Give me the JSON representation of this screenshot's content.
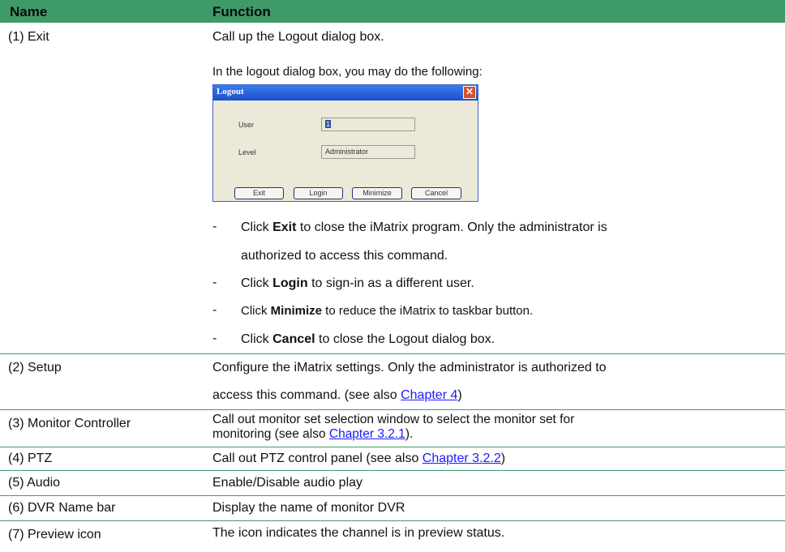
{
  "header": {
    "name": "Name",
    "function": "Function"
  },
  "rows": [
    {
      "name": "(1) Exit",
      "line1": "Call up the Logout dialog box.",
      "line2": "In the logout dialog box, you may do the following:",
      "bullets": [
        {
          "dash": "-",
          "pre": "Click ",
          "bold": "Exit",
          "post": " to close the iMatrix program. Only the administrator is",
          "cont": "authorized to access this command."
        },
        {
          "dash": "-",
          "pre": "Click ",
          "bold": "Login",
          "post": " to sign-in as a different user."
        },
        {
          "dash": "-",
          "pre": "Click ",
          "bold": "Minimize",
          "post": " to reduce the iMatrix to taskbar button."
        },
        {
          "dash": "-",
          "pre": "Click ",
          "bold": "Cancel",
          "post": " to close the Logout dialog box."
        }
      ]
    },
    {
      "name": "(2) Setup",
      "line1": "Configure the iMatrix settings. Only the administrator is authorized to",
      "line2pre": "access this command. (see also ",
      "link": "Chapter 4",
      "post": ")"
    },
    {
      "name": "(3) Monitor Controller",
      "line1": "Call out monitor set selection window to select the monitor set for",
      "line2pre": "monitoring (see also ",
      "link": "Chapter 3.2.1",
      "post": ")."
    },
    {
      "name": "(4) PTZ",
      "pre": "Call out PTZ control panel (see also ",
      "link": "Chapter 3.2.2",
      "post": ")"
    },
    {
      "name": "(5) Audio",
      "text": "Enable/Disable audio play"
    },
    {
      "name": "(6) DVR Name bar",
      "text": "Display the name of monitor DVR"
    },
    {
      "name": "(7) Preview icon",
      "text": "The icon indicates the channel is in preview status."
    }
  ],
  "dialog": {
    "title": "Logout",
    "close_glyph": "✕",
    "user_label": "User",
    "user_value": "1",
    "level_label": "Level",
    "level_value": "Administrator",
    "buttons": [
      "Exit",
      "Login",
      "Minimize",
      "Cancel"
    ]
  },
  "colors": {
    "header_bg": "#3e9b68",
    "link": "#1a1aff",
    "titlebar": "#2a5fdc"
  }
}
